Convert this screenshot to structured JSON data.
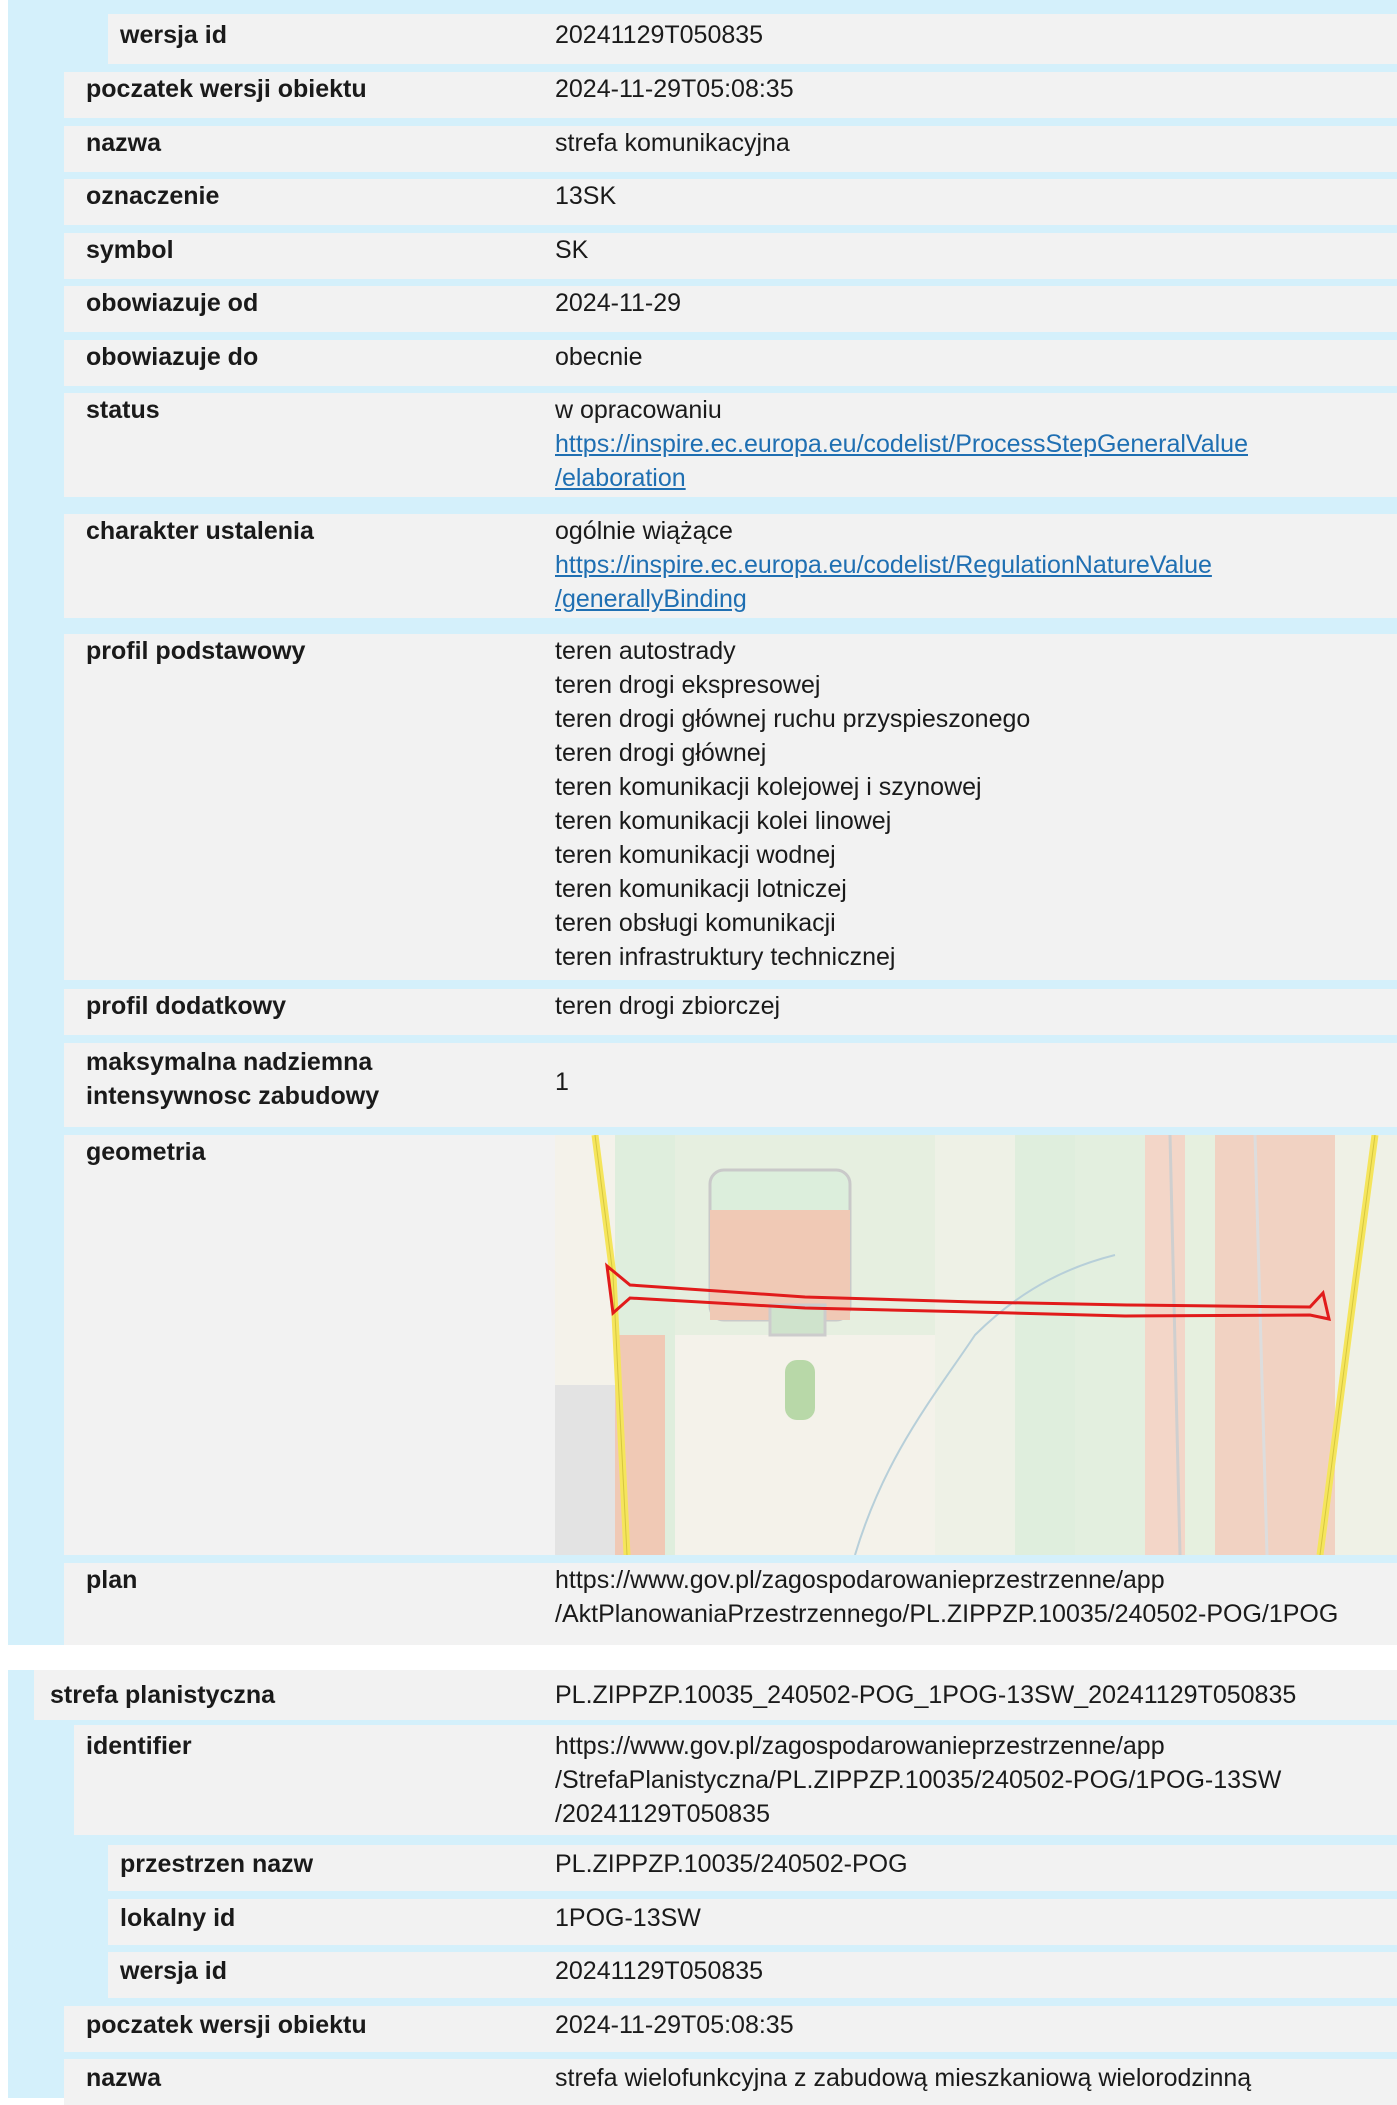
{
  "section1": {
    "rows": [
      {
        "label": "wersja id",
        "value": "20241129T050835"
      },
      {
        "label": "poczatek wersji obiektu",
        "value": "2024-11-29T05:08:35"
      },
      {
        "label": "nazwa",
        "value": "strefa komunikacyjna"
      },
      {
        "label": "oznaczenie",
        "value": "13SK"
      },
      {
        "label": "symbol",
        "value": "SK"
      },
      {
        "label": "obowiazuje od",
        "value": "2024-11-29"
      },
      {
        "label": "obowiazuje do",
        "value": "obecnie"
      },
      {
        "label": "status",
        "value": "w opracowaniu",
        "link1": "https://inspire.ec.europa.eu/codelist/ProcessStepGeneralValue",
        "link2": "/elaboration"
      },
      {
        "label": "charakter ustalenia",
        "value": "ogólnie wiążące",
        "link1": "https://inspire.ec.europa.eu/codelist/RegulationNatureValue",
        "link2": "/generallyBinding"
      },
      {
        "label": "profil podstawowy",
        "values": [
          "teren autostrady",
          "teren drogi ekspresowej",
          "teren drogi głównej ruchu przyspieszonego",
          "teren drogi głównej",
          "teren komunikacji kolejowej i szynowej",
          "teren komunikacji kolei linowej",
          "teren komunikacji wodnej",
          "teren komunikacji lotniczej",
          "teren obsługi komunikacji",
          "teren infrastruktury technicznej"
        ]
      },
      {
        "label": "profil dodatkowy",
        "value": "teren drogi zbiorczej"
      },
      {
        "label_line1": "maksymalna nadziemna",
        "label_line2": "intensywnosc zabudowy",
        "value": "1"
      },
      {
        "label": "geometria"
      },
      {
        "label": "plan",
        "line1": "https://www.gov.pl/zagospodarowanieprzestrzenne/app",
        "line2": "/AktPlanowaniaPrzestrzennego/PL.ZIPPZP.10035/240502-POG/1POG"
      }
    ]
  },
  "section2": {
    "header_label": "strefa planistyczna",
    "header_value": "PL.ZIPPZP.10035_240502-POG_1POG-13SW_20241129T050835",
    "identifier_label": "identifier",
    "identifier_lines": [
      "https://www.gov.pl/zagospodarowanieprzestrzenne/app",
      "/StrefaPlanistyczna/PL.ZIPPZP.10035/240502-POG/1POG-13SW",
      "/20241129T050835"
    ],
    "przestrzen_label": "przestrzen nazw",
    "przestrzen_value": "PL.ZIPPZP.10035/240502-POG",
    "lokalny_label": "lokalny id",
    "lokalny_value": "1POG-13SW",
    "wersja_label": "wersja id",
    "wersja_value": "20241129T050835",
    "poczatek_label": "poczatek wersji obiektu",
    "poczatek_value": "2024-11-29T05:08:35",
    "nazwa_label": "nazwa",
    "nazwa_value": "strefa wielofunkcyjna z zabudową mieszkaniową wielorodzinną"
  }
}
